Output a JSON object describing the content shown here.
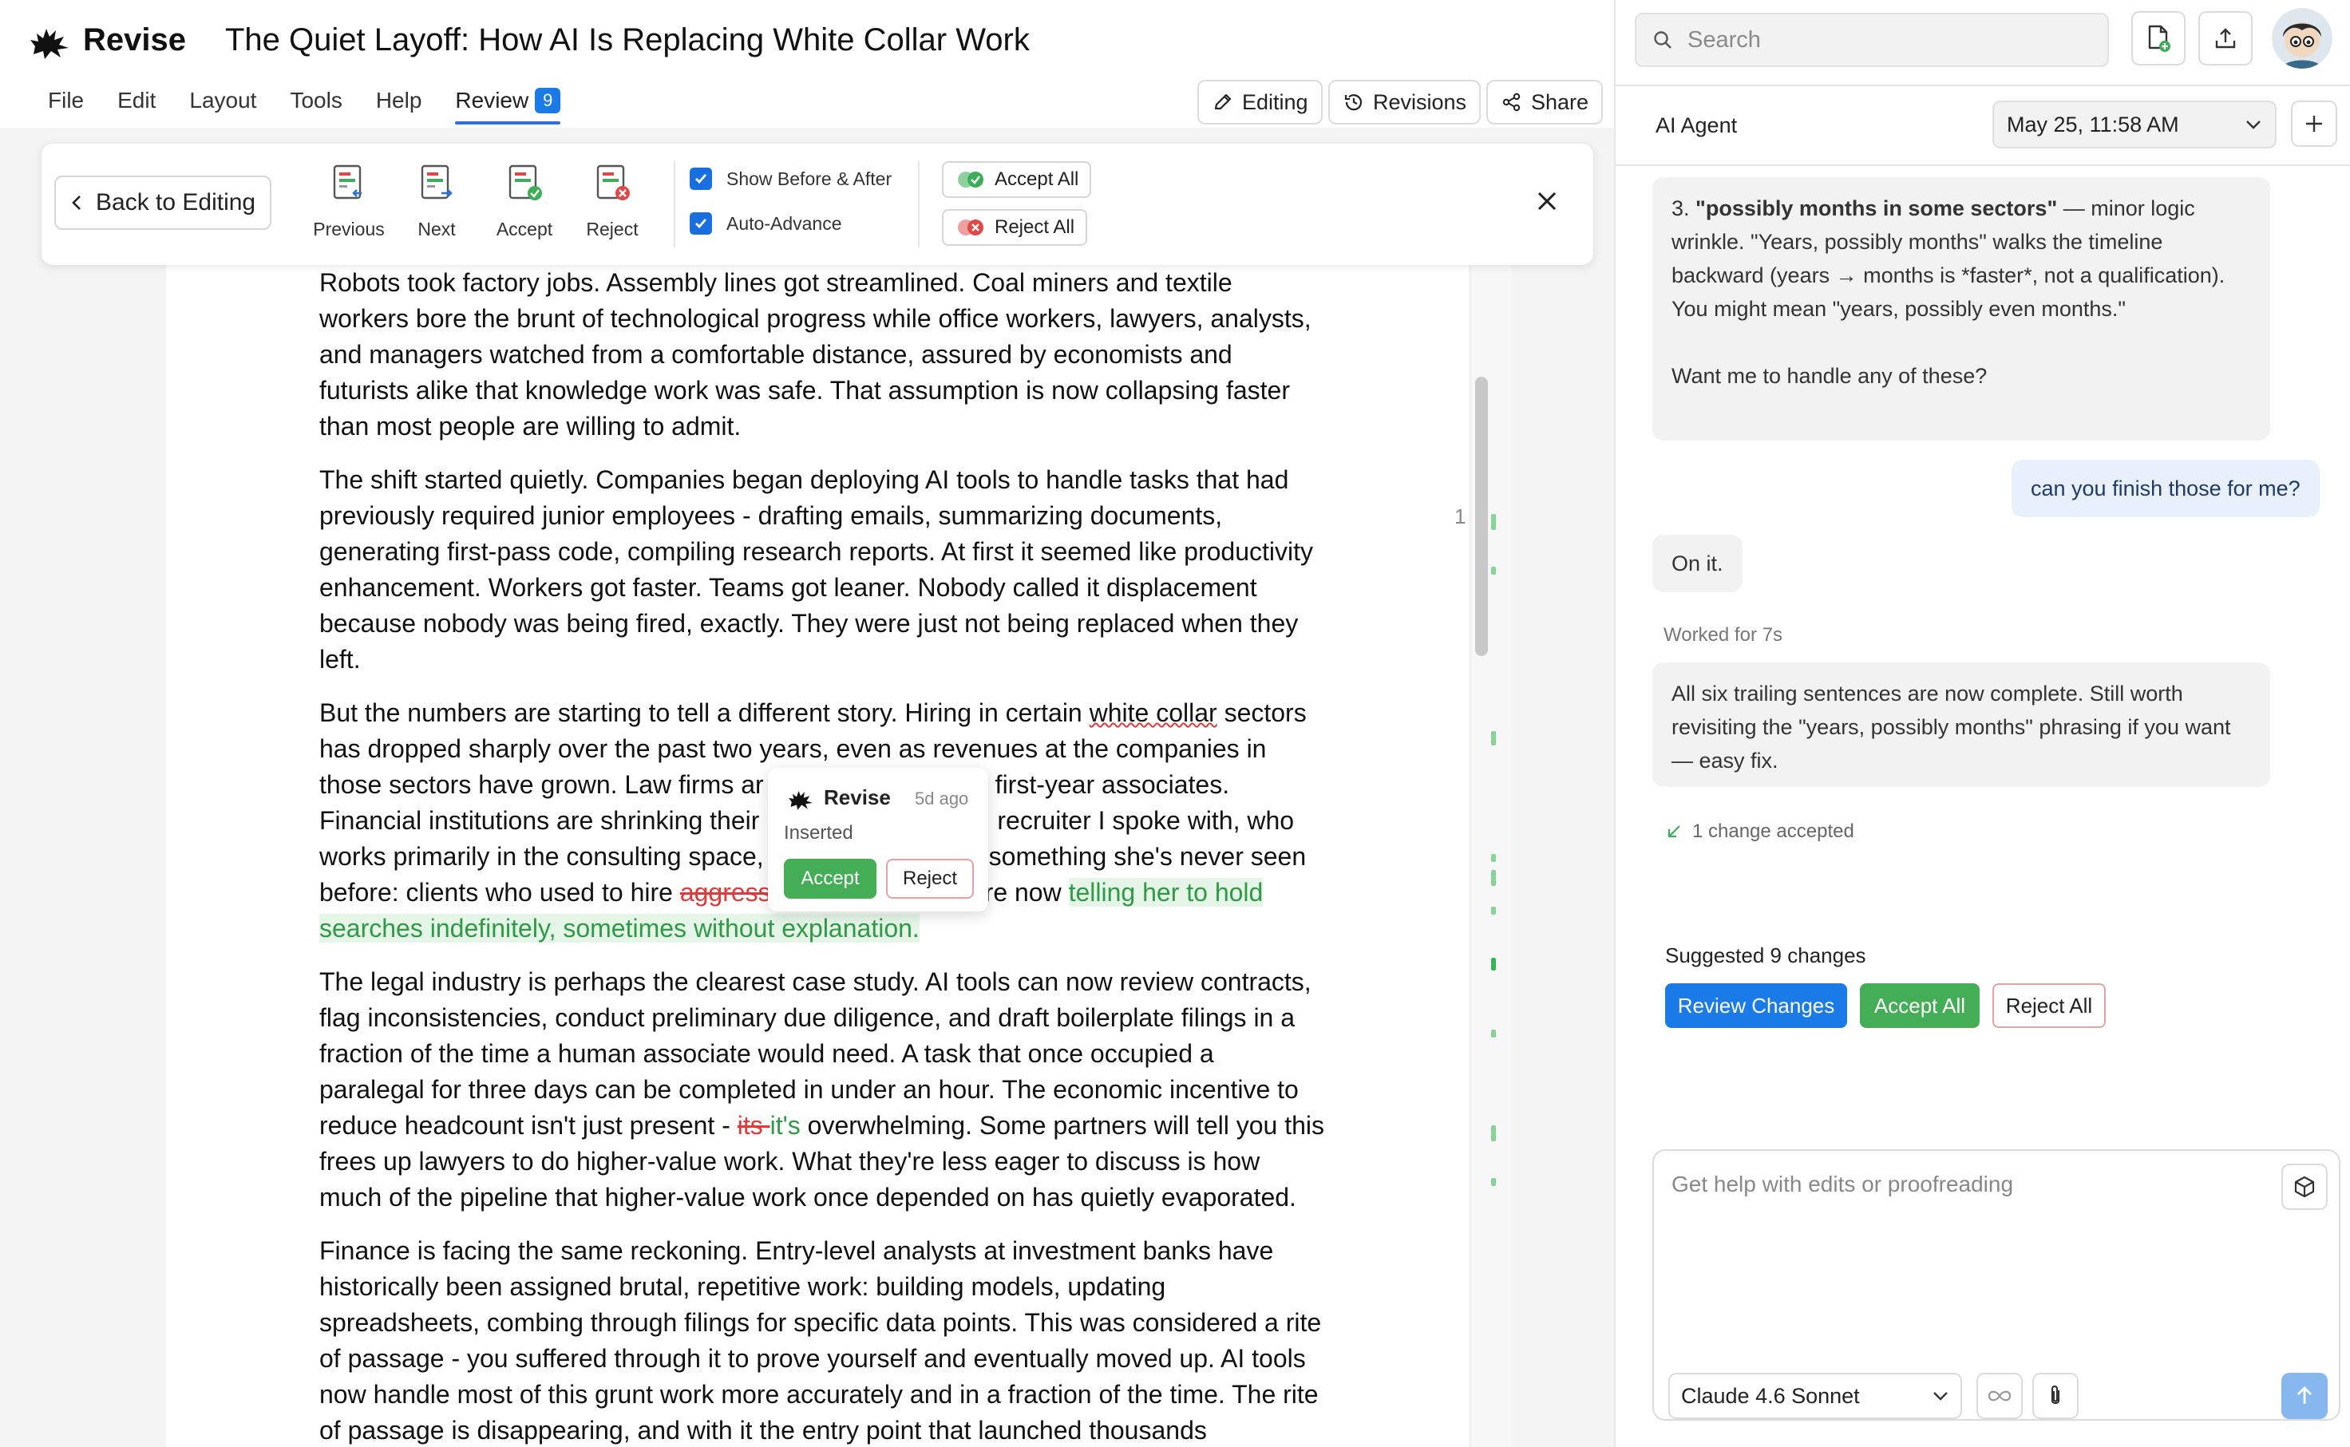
{
  "app": {
    "brand": "Revise",
    "doc_title": "The Quiet Layoff: How AI Is Replacing White Collar Work"
  },
  "menu": [
    {
      "label": "File"
    },
    {
      "label": "Edit"
    },
    {
      "label": "Layout"
    },
    {
      "label": "Tools"
    },
    {
      "label": "Help"
    }
  ],
  "review_tab": {
    "label": "Review",
    "count": "9"
  },
  "modes": {
    "editing": "Editing",
    "revisions": "Revisions",
    "share": "Share"
  },
  "toolbar": {
    "back": "Back to Editing",
    "previous": "Previous",
    "next": "Next",
    "accept": "Accept",
    "reject": "Reject",
    "show_before_after": "Show Before & After",
    "auto_advance": "Auto-Advance",
    "accept_all": "Accept All",
    "reject_all": "Reject All"
  },
  "document": {
    "p1": "Robots took factory jobs. Assembly lines got streamlined. Coal miners and textile workers bore the brunt of technological progress while office workers, lawyers, analysts, and managers watched from a comfortable distance, assured by economists and futurists alike that knowledge work was safe. That assumption is now collapsing faster than most people are willing to admit.",
    "p2": "The shift started quietly. Companies began deploying AI tools to handle tasks that had previously required junior employees  -  drafting emails, summarizing documents, generating first-pass code, compiling research reports. At first it seemed like productivity enhancement. Workers got faster. Teams got leaner. Nobody called it displacement because nobody was being fired, exactly. They were just not being replaced when they left.",
    "p3_a": "But the numbers are starting to tell a different story. Hiring in certain ",
    "p3_squig": "white collar",
    "p3_b": " sectors has dropped sharply over the past two years, even as revenues at the companies in those sectors have grown. Law firms ar",
    "p3_c": "first-year associates. Financial institutions are shrinking their",
    "p3_d": "recruiter I spoke with, who works primarily in the consulting space,",
    "p3_e": "something she's never seen before: clients who used to hire ",
    "p3_del": "aggress",
    "p3_f": "re now ",
    "p3_ins": "telling her to hold searches indefinitely, sometimes without explanation.",
    "p4_a": "The legal industry is perhaps the clearest case study. AI tools can now review contracts, flag inconsistencies, conduct preliminary due diligence, and draft boilerplate filings in a fraction of the time a human associate would need. A task that once occupied a paralegal for three days can be completed in under an hour. The economic incentive to reduce headcount isn't just present  -  ",
    "p4_del": "its ",
    "p4_ins": "it's",
    "p4_b": " overwhelming. Some partners will tell you this frees up lawyers to do higher-value work. What they're less eager to discuss is how much of the pipeline that higher-value work once depended on has quietly evaporated.",
    "p5": "Finance is facing the same reckoning. Entry-level analysts at investment banks have historically been assigned brutal, repetitive work: building models, updating spreadsheets, combing through filings for specific data points. This was considered a rite of passage  -  you suffered through it to prove yourself and eventually moved up. AI tools now handle most of this grunt work more accurately and in a fraction of the time. The rite of passage is disappearing, and with it the entry point that launched thousands"
  },
  "gutter": {
    "page_marker": "1"
  },
  "popup": {
    "name": "Revise",
    "time": "5d ago",
    "status": "Inserted",
    "accept": "Accept",
    "reject": "Reject"
  },
  "sidebar": {
    "search_placeholder": "Search",
    "agent_title": "AI Agent",
    "session_date": "May 25, 11:58 AM",
    "msg1_bold": "\"possibly months in some sectors\"",
    "msg1_prefix": "3. ",
    "msg1_rest": " — minor logic wrinkle. \"Years, possibly months\" walks the timeline backward (years → months is *faster*, not a qualification). You might mean \"years, possibly even months.\"",
    "msg1_q": "Want me to handle any of these?",
    "user_msg": "can you finish those for me?",
    "msg2": "On it.",
    "worked": "Worked for 7s",
    "msg3": "All six trailing sentences are now complete. Still worth revisiting the \"years, possibly months\" phrasing if you want — easy fix.",
    "accepted": "1 change accepted",
    "suggested": "Suggested 9 changes",
    "review_changes": "Review Changes",
    "accept_all": "Accept All",
    "reject_all": "Reject All",
    "composer_placeholder": "Get help with edits or proofreading",
    "model": "Claude 4.6 Sonnet"
  },
  "colors": {
    "accent": "#1a7be8",
    "accept": "#44ae57",
    "reject": "#e03a3a",
    "insert_bg": "#e5f6e8"
  }
}
